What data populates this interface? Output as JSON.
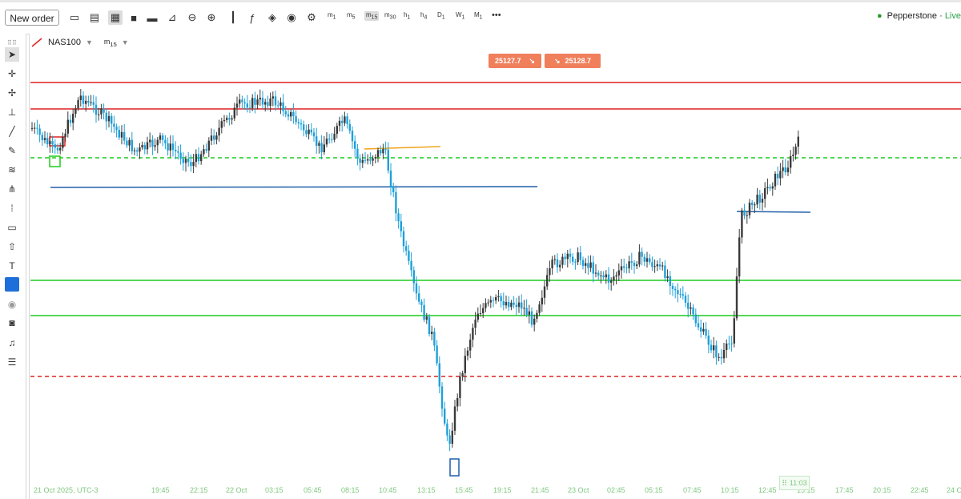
{
  "toolbar": {
    "new_order_label": "New order",
    "timeframes": [
      {
        "main": "m",
        "sub": "1"
      },
      {
        "main": "m",
        "sub": "5"
      },
      {
        "main": "m",
        "sub": "15"
      },
      {
        "main": "m",
        "sub": "30"
      },
      {
        "main": "h",
        "sub": "1"
      },
      {
        "main": "h",
        "sub": "4"
      },
      {
        "main": "D",
        "sub": "1"
      },
      {
        "main": "W",
        "sub": "1"
      },
      {
        "main": "M",
        "sub": "1"
      }
    ],
    "more_label": "•••",
    "broker_name": "Pepperstone",
    "broker_status": "Live"
  },
  "symbol": {
    "name": "NAS100",
    "timeframe_main": "m",
    "timeframe_sub": "15"
  },
  "quotes": {
    "sell": "25127.7",
    "buy": "25128.7"
  },
  "time_axis": {
    "labels": [
      "21 Oct 2025, UTC-3",
      "19:45",
      "22:15",
      "22 Oct",
      "03:15",
      "05:45",
      "08:15",
      "10:45",
      "13:15",
      "15:45",
      "19:15",
      "21:45",
      "23 Oct",
      "02:45",
      "05:15",
      "07:45",
      "10:15",
      "12:45",
      "15:15",
      "17:45",
      "20:15",
      "22:45",
      "24 O"
    ],
    "cursor_time": "11:03"
  },
  "chart_data": {
    "type": "candlestick",
    "symbol": "NAS100",
    "colors": {
      "up": "#3a3a3a",
      "down": "#1fa0d8",
      "resistance": "#e02020",
      "support": "#1ecc1e",
      "trend": "#1f5fa8",
      "orange": "#f2a31b"
    }
  }
}
